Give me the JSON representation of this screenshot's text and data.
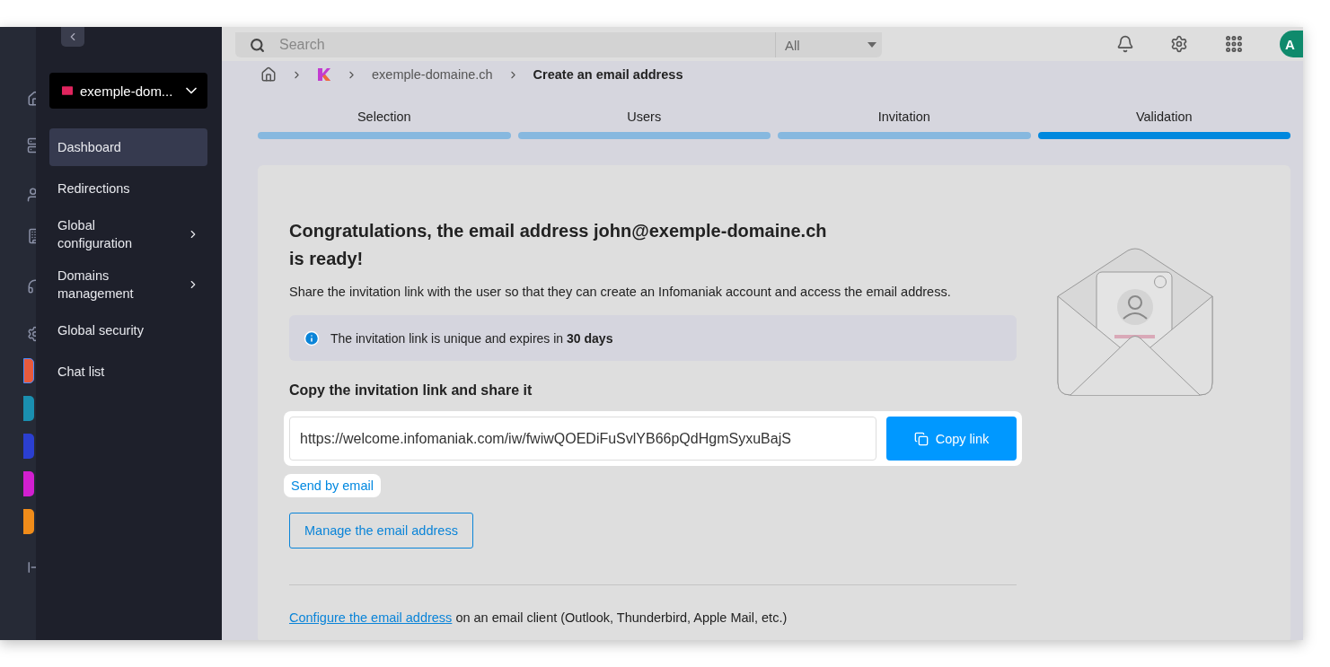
{
  "topbar": {
    "search": {
      "placeholder": "Search"
    },
    "filter": "All",
    "avatar": "A"
  },
  "sidebar": {
    "domain_selector": "exemple-dom...",
    "items": [
      {
        "label": "Dashboard",
        "selected": true,
        "has_submenu": false
      },
      {
        "label": "Redirections",
        "selected": false,
        "has_submenu": false
      },
      {
        "label": "Global configuration",
        "selected": false,
        "has_submenu": true
      },
      {
        "label": "Domains management",
        "selected": false,
        "has_submenu": true
      },
      {
        "label": "Global security",
        "selected": false,
        "has_submenu": false
      },
      {
        "label": "Chat list",
        "selected": false,
        "has_submenu": false
      }
    ]
  },
  "breadcrumb": [
    "exemple-domaine.ch",
    "Create an email address"
  ],
  "steps": [
    {
      "label": "Selection",
      "selected": false
    },
    {
      "label": "Users",
      "selected": false
    },
    {
      "label": "Invitation",
      "selected": false
    },
    {
      "label": "Validation",
      "selected": true
    }
  ],
  "card": {
    "title": "Congratulations, the email address john@exemple-domaine.ch",
    "title_line2": "is ready!",
    "description": "Share the invitation link with the user so that they can create an Infomaniak account and access the email address.",
    "info": "The invitation link is unique and expires in **30 days**",
    "link_heading": "Copy the invitation link and share it",
    "link": "https://welcome.infomaniak.com/iw/fwiwQOEDiFuSvlYB66pQdHgmSyxuBajS",
    "copy_button": "Copy link",
    "send_link": "Send by email",
    "manage_button": "Manage the email address",
    "footer_link": "Configure the email address",
    "footer_text": "on an email client (Outlook, Thunderbird, Apple Mail, etc.)"
  }
}
